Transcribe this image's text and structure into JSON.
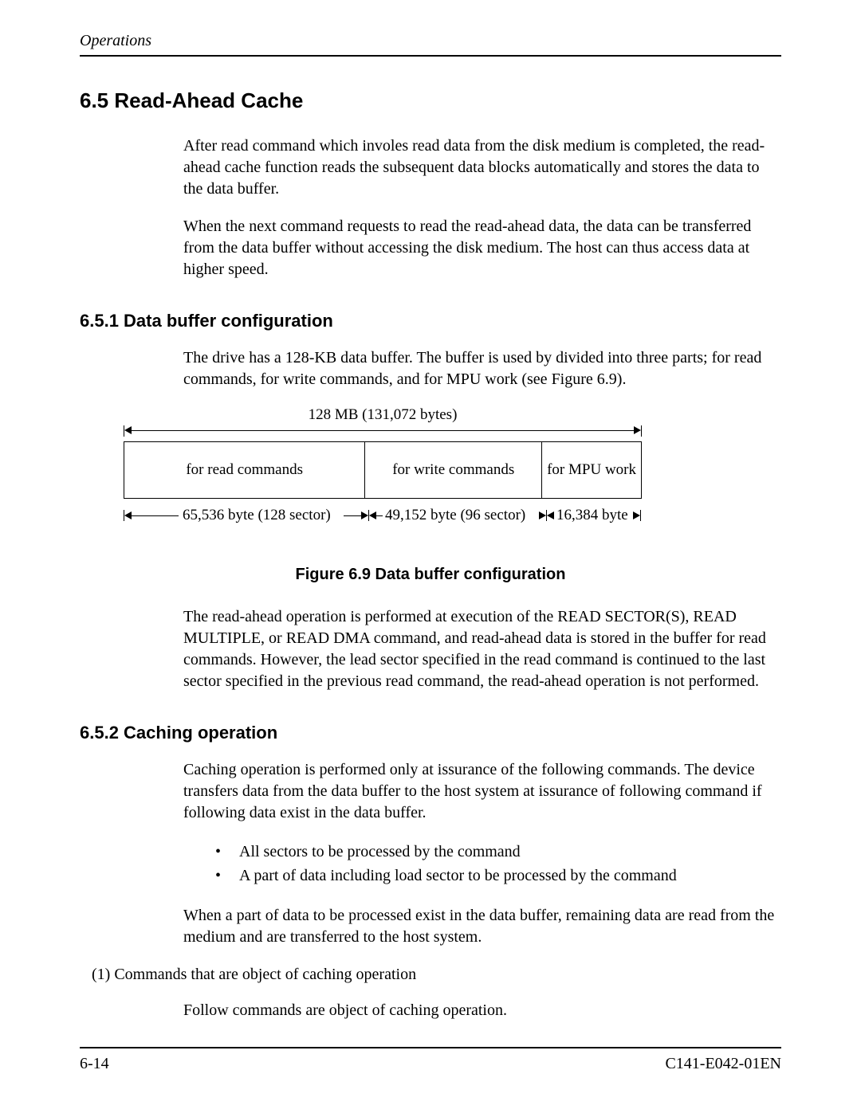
{
  "header": {
    "running": "Operations"
  },
  "sections": {
    "h65": "6.5  Read-Ahead Cache",
    "p1": "After read command which involes read data from the disk medium is completed, the read-ahead cache function reads the subsequent data blocks automatically and stores the data to the data buffer.",
    "p2": "When the next command requests to read the read-ahead data, the data can be transferred from the data buffer without accessing the disk medium.  The host can thus access data at higher speed.",
    "h651": "6.5.1  Data buffer configuration",
    "p3": "The drive has a 128-KB data buffer.  The buffer is used by divided into three parts; for read commands, for write commands, and for MPU work (see Figure 6.9).",
    "fig_caption": "Figure 6.9  Data buffer configuration",
    "p4": "The read-ahead operation is performed at execution of the READ SECTOR(S), READ MULTIPLE, or READ DMA command, and read-ahead data is stored in the buffer for read commands.  However, the lead sector specified in the read command is continued to the last sector specified in the previous read command, the read-ahead operation is not performed.",
    "h652": "6.5.2  Caching operation",
    "p5": "Caching operation is performed only at issurance of the following commands.  The device transfers data from the data buffer to the host system at issurance of following command if following data exist in the data buffer.",
    "b1": "All sectors to be processed by the command",
    "b2": "A part of data including load sector to be processed by the command",
    "p6": "When a part of data to be processed exist in the data buffer, remaining data are read from the medium and are transferred to the host system.",
    "l1": "(1)   Commands that are object of caching operation",
    "p7": "Follow commands are object of caching operation."
  },
  "diagram": {
    "top": "128 MB (131,072 bytes)",
    "read": "for read commands",
    "write": "for write commands",
    "mpu": "for MPU work",
    "read_sz": "65,536 byte (128 sector)",
    "write_sz": "49,152 byte (96 sector)",
    "mpu_sz": "16,384 byte"
  },
  "footer": {
    "left": "6-14",
    "right": "C141-E042-01EN"
  }
}
